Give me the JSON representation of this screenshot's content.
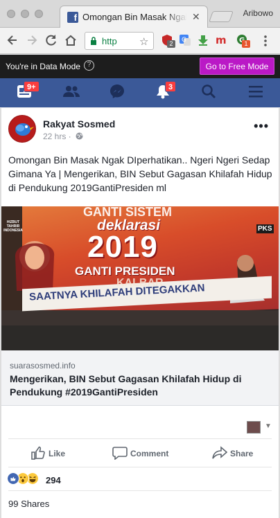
{
  "browser": {
    "tab_title": "Omongan Bin Masak Ngak DIperhatikan..",
    "profile_name": "Aribowo",
    "url_text": "http",
    "extensions": [
      {
        "name": "ext-red-shield",
        "badge": "2",
        "badge_color": "#666666"
      },
      {
        "name": "google-translate",
        "badge": "",
        "badge_color": ""
      },
      {
        "name": "download-arrow",
        "badge": "",
        "badge_color": ""
      },
      {
        "name": "mendeley-m",
        "badge": "",
        "badge_color": ""
      },
      {
        "name": "green-ext",
        "badge": "1",
        "badge_color": "#e8542e"
      }
    ]
  },
  "data_mode": {
    "text": "You're in Data Mode",
    "help": "?",
    "button": "Go to Free Mode"
  },
  "fb_nav": {
    "home_badge": "9+",
    "notifications_badge": "3"
  },
  "post": {
    "author": "Rakyat Sosmed",
    "meta": "22 hrs ·",
    "message": "Omongan Bin Masak Ngak DIperhatikan.. Ngeri Ngeri Sedap Gimana Ya | Mengerikan, BIN Sebut Gagasan Khilafah Hidup di Pendukung 2019GantiPresiden ml",
    "photo": {
      "line1": "GANTI SISTEM",
      "line2": "deklarasi",
      "line3": "2019",
      "line4": "GANTI PRESIDEN",
      "line5": "KALBAR",
      "line6": "SAATNYA KHILAFAH DITEGAKKAN",
      "logo_left": "HIZBUT TAHRIR INDONESIA",
      "logo_right": "PKS"
    },
    "link": {
      "domain": "suarasosmed.info",
      "title": "Mengerikan, BIN Sebut Gagasan Khilafah Hidup di Pendukung #2019GantiPresiden"
    },
    "actions": {
      "like": "Like",
      "comment": "Comment",
      "share": "Share"
    },
    "reaction_count": "294",
    "shares": "99 Shares"
  },
  "colors": {
    "fb_blue": "#3b5998",
    "free_mode": "#ba19c6",
    "badge_red": "#fa3e3e"
  }
}
